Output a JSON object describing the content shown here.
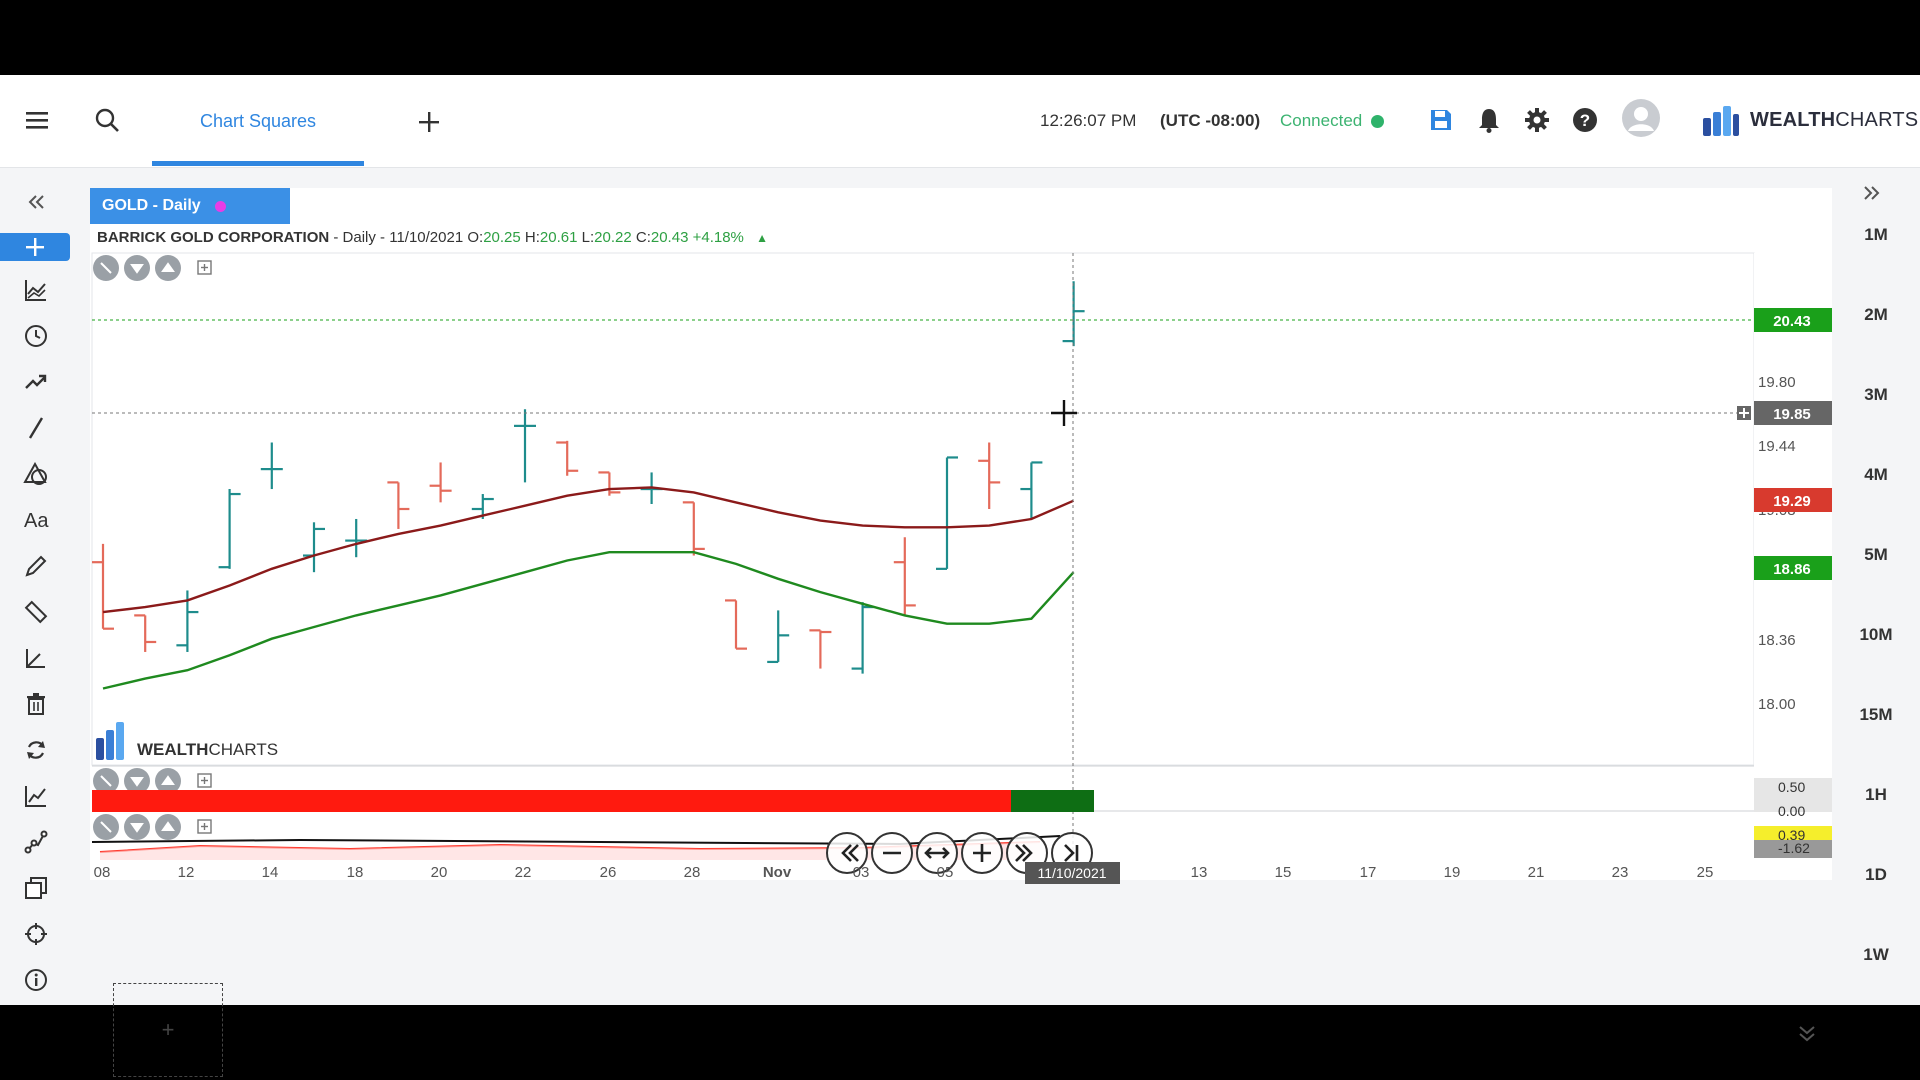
{
  "header": {
    "tab_label": "Chart Squares",
    "time": "12:26:07 PM",
    "timezone": "(UTC -08:00)",
    "connection": "Connected",
    "brand_bold": "WEALTH",
    "brand_light": "CHARTS"
  },
  "panel": {
    "tab_label": "GOLD - Daily",
    "company": "BARRICK GOLD CORPORATION",
    "meta": " - Daily - 11/10/2021",
    "open_label": "O:",
    "open": "20.25",
    "high_label": "H:",
    "high": "20.61",
    "low_label": "L:",
    "low": "20.22",
    "close_label": "C:",
    "close": "20.43",
    "change": "+4.18%",
    "watermark_bold": "WEALTH",
    "watermark_light": "CHARTS",
    "crosshair_date": "11/10/2021",
    "add_panel": "+"
  },
  "timeframes": [
    "1M",
    "2M",
    "3M",
    "4M",
    "5M",
    "10M",
    "15M",
    "1H",
    "1D",
    "1W"
  ],
  "colors": {
    "accent": "#2f86e0",
    "up": "#1e8c8c",
    "down": "#e46a5a",
    "ma_fast": "#8b1a1a",
    "ma_slow": "#1f8a1f"
  },
  "chart_data": {
    "type": "ohlc",
    "y_axis_ticks": [
      "19.80",
      "19.44",
      "19.08",
      "18.36",
      "18.00"
    ],
    "price_badges": [
      {
        "value": "20.43",
        "color": "#1aa01a"
      },
      {
        "value": "19.85",
        "color": "#666666"
      },
      {
        "value": "19.29",
        "color": "#d83a2e"
      },
      {
        "value": "18.86",
        "color": "#1aa01a"
      }
    ],
    "x_axis_ticks": [
      "08",
      "12",
      "14",
      "18",
      "20",
      "22",
      "26",
      "28",
      "Nov",
      "03",
      "05",
      "",
      "13",
      "15",
      "17",
      "19",
      "21",
      "23",
      "25"
    ],
    "bars": [
      {
        "o": 18.92,
        "h": 19.03,
        "l": 18.52,
        "c": 18.52
      },
      {
        "o": 18.6,
        "h": 18.6,
        "l": 18.38,
        "c": 18.44
      },
      {
        "o": 18.42,
        "h": 18.75,
        "l": 18.38,
        "c": 18.62
      },
      {
        "o": 18.89,
        "h": 19.36,
        "l": 18.88,
        "c": 19.33
      },
      {
        "o": 19.48,
        "h": 19.64,
        "l": 19.36,
        "c": 19.48
      },
      {
        "o": 18.96,
        "h": 19.16,
        "l": 18.86,
        "c": 19.12
      },
      {
        "o": 19.05,
        "h": 19.18,
        "l": 18.95,
        "c": 19.05
      },
      {
        "o": 19.4,
        "h": 19.4,
        "l": 19.12,
        "c": 19.24
      },
      {
        "o": 19.38,
        "h": 19.52,
        "l": 19.28,
        "c": 19.35
      },
      {
        "o": 19.24,
        "h": 19.33,
        "l": 19.18,
        "c": 19.3
      },
      {
        "o": 19.74,
        "h": 19.84,
        "l": 19.4,
        "c": 19.74
      },
      {
        "o": 19.64,
        "h": 19.65,
        "l": 19.44,
        "c": 19.47
      },
      {
        "o": 19.46,
        "h": 19.46,
        "l": 19.32,
        "c": 19.34
      },
      {
        "o": 19.36,
        "h": 19.46,
        "l": 19.27,
        "c": 19.36
      },
      {
        "o": 19.28,
        "h": 19.28,
        "l": 18.96,
        "c": 19.0
      },
      {
        "o": 18.69,
        "h": 18.69,
        "l": 18.4,
        "c": 18.4
      },
      {
        "o": 18.32,
        "h": 18.63,
        "l": 18.32,
        "c": 18.48
      },
      {
        "o": 18.51,
        "h": 18.51,
        "l": 18.28,
        "c": 18.5
      },
      {
        "o": 18.28,
        "h": 18.68,
        "l": 18.25,
        "c": 18.65
      },
      {
        "o": 18.92,
        "h": 19.07,
        "l": 18.6,
        "c": 18.66
      },
      {
        "o": 18.88,
        "h": 19.55,
        "l": 18.88,
        "c": 19.55
      },
      {
        "o": 19.53,
        "h": 19.64,
        "l": 19.24,
        "c": 19.4
      },
      {
        "o": 19.36,
        "h": 19.52,
        "l": 19.18,
        "c": 19.52
      },
      {
        "o": 20.25,
        "h": 20.61,
        "l": 20.22,
        "c": 20.43
      }
    ],
    "ma_fast": [
      18.62,
      18.65,
      18.69,
      18.78,
      18.88,
      18.96,
      19.03,
      19.09,
      19.14,
      19.2,
      19.26,
      19.32,
      19.36,
      19.37,
      19.34,
      19.28,
      19.22,
      19.17,
      19.14,
      19.13,
      19.13,
      19.14,
      19.18,
      19.29
    ],
    "ma_slow": [
      18.16,
      18.22,
      18.27,
      18.36,
      18.46,
      18.53,
      18.6,
      18.66,
      18.72,
      18.79,
      18.86,
      18.93,
      18.98,
      18.98,
      18.98,
      18.91,
      18.82,
      18.74,
      18.67,
      18.6,
      18.55,
      18.55,
      18.58,
      18.86
    ]
  }
}
